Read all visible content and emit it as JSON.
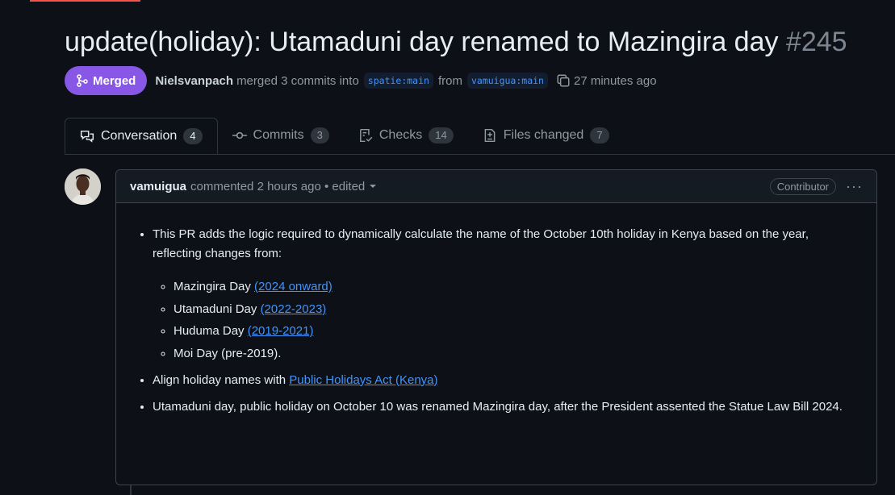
{
  "pr": {
    "title": "update(holiday): Utamaduni day renamed to Mazingira day",
    "number": "#245",
    "status": "Merged",
    "merger": "Nielsvanpach",
    "merge_text": "merged 3 commits into",
    "base_branch": "spatie:main",
    "from_text": "from",
    "head_branch": "vamuigua:main",
    "time": "27 minutes ago"
  },
  "tabs": [
    {
      "label": "Conversation",
      "count": "4",
      "icon": "comment-discussion-icon"
    },
    {
      "label": "Commits",
      "count": "3",
      "icon": "git-commit-icon"
    },
    {
      "label": "Checks",
      "count": "14",
      "icon": "checklist-icon"
    },
    {
      "label": "Files changed",
      "count": "7",
      "icon": "file-diff-icon"
    }
  ],
  "comment": {
    "author": "vamuigua",
    "action": "commented 2 hours ago • edited",
    "role": "Contributor",
    "bullet1": "This PR adds the logic required to dynamically calculate the name of the October 10th holiday in Kenya based on the year, reflecting changes from:",
    "sub": [
      {
        "text": "Mazingira Day ",
        "link": "(2024 onward)"
      },
      {
        "text": "Utamaduni Day ",
        "link": "(2022-2023)"
      },
      {
        "text": "Huduma Day ",
        "link": "(2019-2021)"
      },
      {
        "text": "Moi Day (pre-2019).",
        "link": ""
      }
    ],
    "bullet2_text": "Align holiday names with ",
    "bullet2_link": "Public Holidays Act (Kenya)",
    "bullet3": "Utamaduni day, public holiday on October 10 was renamed Mazingira day, after the President assented the Statue Law Bill 2024."
  },
  "colors": {
    "merged": "#8957e5",
    "link": "#4493f8",
    "background": "#0d1117"
  }
}
